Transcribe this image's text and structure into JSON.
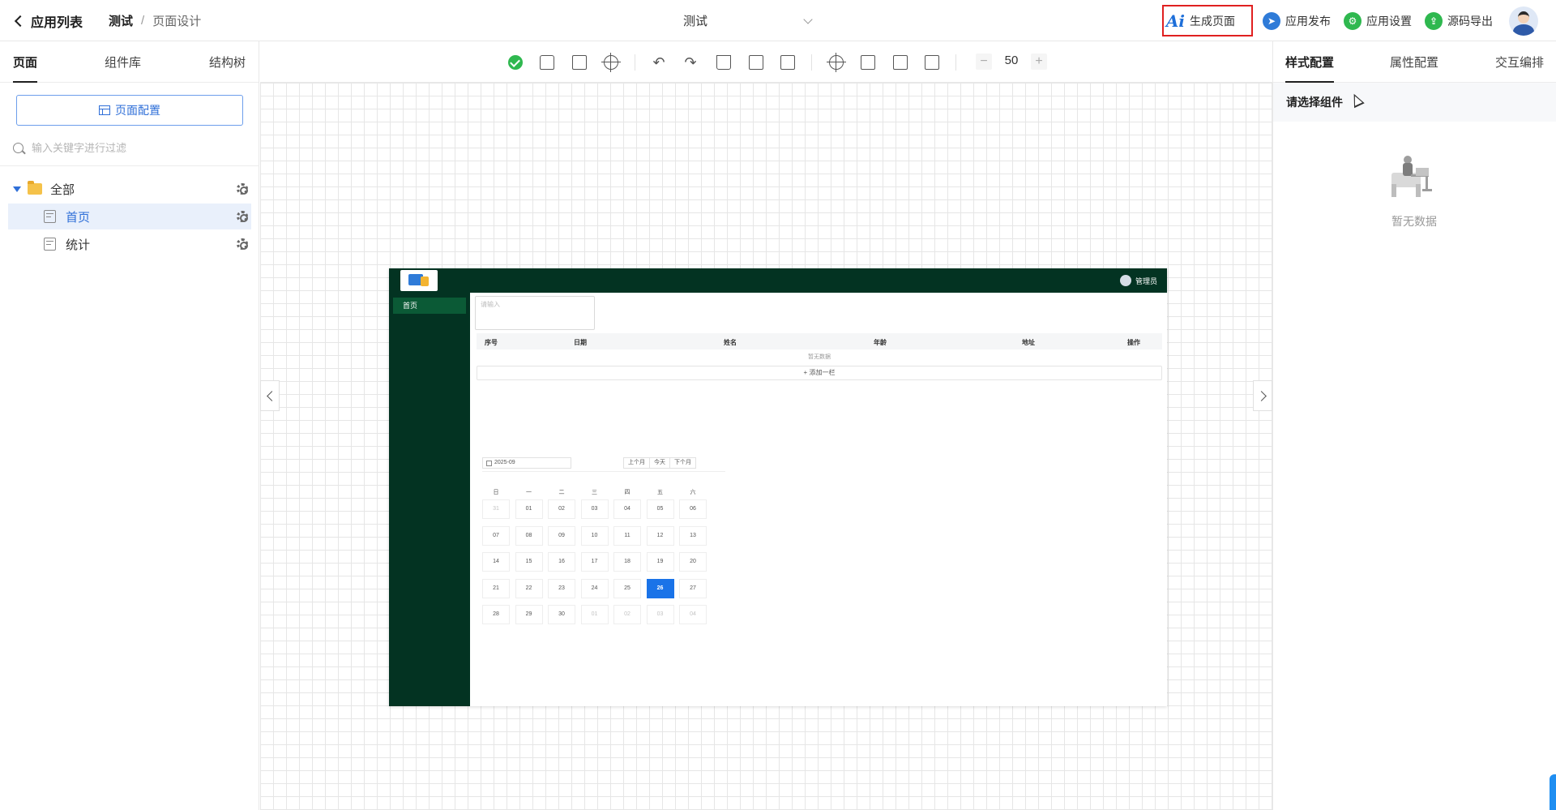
{
  "header": {
    "back_label": "应用列表",
    "crumb_app": "测试",
    "crumb_sep": "/",
    "crumb_page": "页面设计",
    "center_title": "测试",
    "actions": {
      "ai_icon": "Ai",
      "generate": "生成页面",
      "publish": "应用发布",
      "settings": "应用设置",
      "export": "源码导出"
    }
  },
  "left": {
    "tabs": [
      "页面",
      "组件库",
      "结构树"
    ],
    "page_config_button": "页面配置",
    "filter_placeholder": "输入关键字进行过滤",
    "tree": {
      "root": "全部",
      "pages": [
        "首页",
        "统计"
      ]
    }
  },
  "toolbar": {
    "zoom_minus": "−",
    "zoom_value": "50",
    "zoom_plus": "+"
  },
  "preview": {
    "user": "管理员",
    "menu_item": "首页",
    "textarea_placeholder": "请输入",
    "table_headers": [
      "序号",
      "日期",
      "姓名",
      "年龄",
      "地址",
      "操作"
    ],
    "empty_text": "暂无数据",
    "add_row": "+ 添加一栏",
    "calendar": {
      "month": "2025-09",
      "nav": [
        "上个月",
        "今天",
        "下个月"
      ],
      "weekdays": [
        "日",
        "一",
        "二",
        "三",
        "四",
        "五",
        "六"
      ],
      "days": [
        [
          "31",
          "01",
          "02",
          "03",
          "04",
          "05",
          "06"
        ],
        [
          "07",
          "08",
          "09",
          "10",
          "11",
          "12",
          "13"
        ],
        [
          "14",
          "15",
          "16",
          "17",
          "18",
          "19",
          "20"
        ],
        [
          "21",
          "22",
          "23",
          "24",
          "25",
          "26",
          "27"
        ],
        [
          "28",
          "29",
          "30",
          "01",
          "02",
          "03",
          "04"
        ]
      ],
      "today": "26",
      "accent_color": "#1a73e8"
    },
    "theme_color": "#033322"
  },
  "right": {
    "tabs": [
      "样式配置",
      "属性配置",
      "交互编排"
    ],
    "subheader": "请选择组件",
    "empty_text": "暂无数据"
  },
  "colors": {
    "primary": "#2f6fd8",
    "highlight_border": "#e02020",
    "success": "#2fb84f"
  },
  "icons": {
    "toolbar": [
      "check-circle-icon",
      "unlock-icon",
      "save-icon",
      "target-icon",
      "undo-icon",
      "redo-icon",
      "delete-icon",
      "copy-icon",
      "paste-icon",
      "preview-icon",
      "code-icon",
      "validate-icon",
      "crop-icon"
    ]
  }
}
